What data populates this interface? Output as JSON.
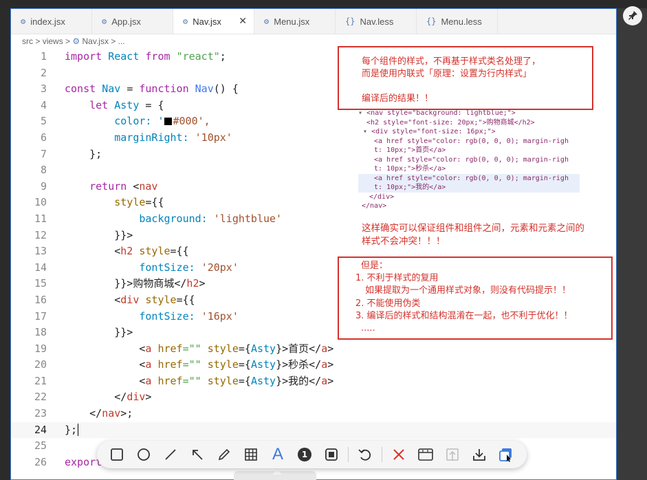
{
  "tabs": [
    {
      "icon": "⚙",
      "label": "index.jsx"
    },
    {
      "icon": "⚙",
      "label": "App.jsx"
    },
    {
      "icon": "⚙",
      "label": "Nav.jsx",
      "active": true,
      "close": "✕"
    },
    {
      "icon": "⚙",
      "label": "Menu.jsx"
    },
    {
      "icon": "{}",
      "label": "Nav.less"
    },
    {
      "icon": "{}",
      "label": "Menu.less"
    }
  ],
  "breadcrumb": {
    "part1": "src",
    "part2": "views",
    "part3": "Nav.jsx",
    "part4": "..."
  },
  "annotation_top": {
    "line1": "每个组件的样式，不再基于样式类名处理了，",
    "line2": "而是使用内联式「原理：设置为行内样式」",
    "line3": "编译后的结果！！"
  },
  "dom_output": {
    "l1": "<nav style=\"background: lightblue;\">",
    "l2": "<h2 style=\"font-size: 20px;\">购物商城</h2>",
    "l3": "<div style=\"font-size: 16px;\">",
    "l4a": "<a href style=\"color: rgb(0, 0, 0); margin-righ",
    "l4b": "t: 10px;\">首页</a>",
    "l5a": "<a href style=\"color: rgb(0, 0, 0); margin-righ",
    "l5b": "t: 10px;\">秒杀</a>",
    "l6a": "<a href style=\"color: rgb(0, 0, 0); margin-righ",
    "l6b": "t: 10px;\">我的</a>",
    "l7": "</div>",
    "l8": "</nav>"
  },
  "middle_note": {
    "line1": "这样确实可以保证组件和组件之间，元素和元素之间的",
    "line2": "样式不会冲突！！！"
  },
  "annotation_bottom": {
    "l1": "但是：",
    "l2": "1. 不利于样式的复用",
    "l3": "如果提取为一个通用样式对象，则没有代码提示！！",
    "l4": "2. 不能使用伪类",
    "l5": "3. 编译后的样式和结构混淆在一起，也不利于优化！！",
    "l6": "....."
  },
  "code_lines": [
    "1",
    "2",
    "3",
    "4",
    "5",
    "6",
    "7",
    "8",
    "9",
    "10",
    "11",
    "12",
    "13",
    "14",
    "15",
    "16",
    "17",
    "18",
    "19",
    "20",
    "21",
    "22",
    "23",
    "24",
    "25",
    "26"
  ],
  "code": {
    "l1": [
      "import",
      "React",
      "from",
      "\"react\"",
      ";"
    ],
    "l3": [
      "const",
      "Nav",
      "=",
      "function",
      "Nav",
      "() {"
    ],
    "l4": [
      "let",
      "Asty",
      "= {"
    ],
    "l5": [
      "color: '",
      "#000",
      "',"
    ],
    "l6": [
      "marginRight: ",
      "'10px'"
    ],
    "l7": "};",
    "l9": [
      "return",
      "<",
      "nav"
    ],
    "l10": [
      "style",
      "={{"
    ],
    "l11": [
      "background: ",
      "'lightblue'"
    ],
    "l12": [
      "}}>"
    ],
    "l13": [
      "<",
      "h2",
      "style",
      "={{"
    ],
    "l14": [
      "fontSize: ",
      "'20px'"
    ],
    "l15": [
      "}}>",
      "购物商城",
      "</",
      "h2",
      ">"
    ],
    "l16": [
      "<",
      "div",
      "style",
      "={{"
    ],
    "l17": [
      "fontSize: ",
      "'16px'"
    ],
    "l18": [
      "}}>"
    ],
    "l19": [
      "<",
      "a",
      "href",
      "=\"\"",
      "style",
      "={",
      "Asty",
      "}>",
      "首页",
      "</",
      "a",
      ">"
    ],
    "l20": [
      "<",
      "a",
      "href",
      "=\"\"",
      "style",
      "={",
      "Asty",
      "}>",
      "秒杀",
      "</",
      "a",
      ">"
    ],
    "l21": [
      "<",
      "a",
      "href",
      "=\"\"",
      "style",
      "={",
      "Asty",
      "}>",
      "我的",
      "</",
      "a",
      ">"
    ],
    "l22": [
      "</",
      "div",
      ">"
    ],
    "l23": [
      "</",
      "nav",
      ">;"
    ],
    "l24": "};",
    "l26": "export"
  },
  "toolbar": {
    "items": [
      "rectangle-icon",
      "circle-icon",
      "line-icon",
      "arrow-icon",
      "pen-icon",
      "mosaic-icon",
      "text-icon",
      "number-icon",
      "border-icon",
      "undo-icon",
      "close-icon",
      "window-icon",
      "pin-to-screen-icon",
      "download-icon",
      "copy-icon"
    ],
    "number_label": "1",
    "text_label": "A"
  },
  "colors": {
    "accent": "#3b7bd6",
    "annotation": "#d4322b"
  }
}
